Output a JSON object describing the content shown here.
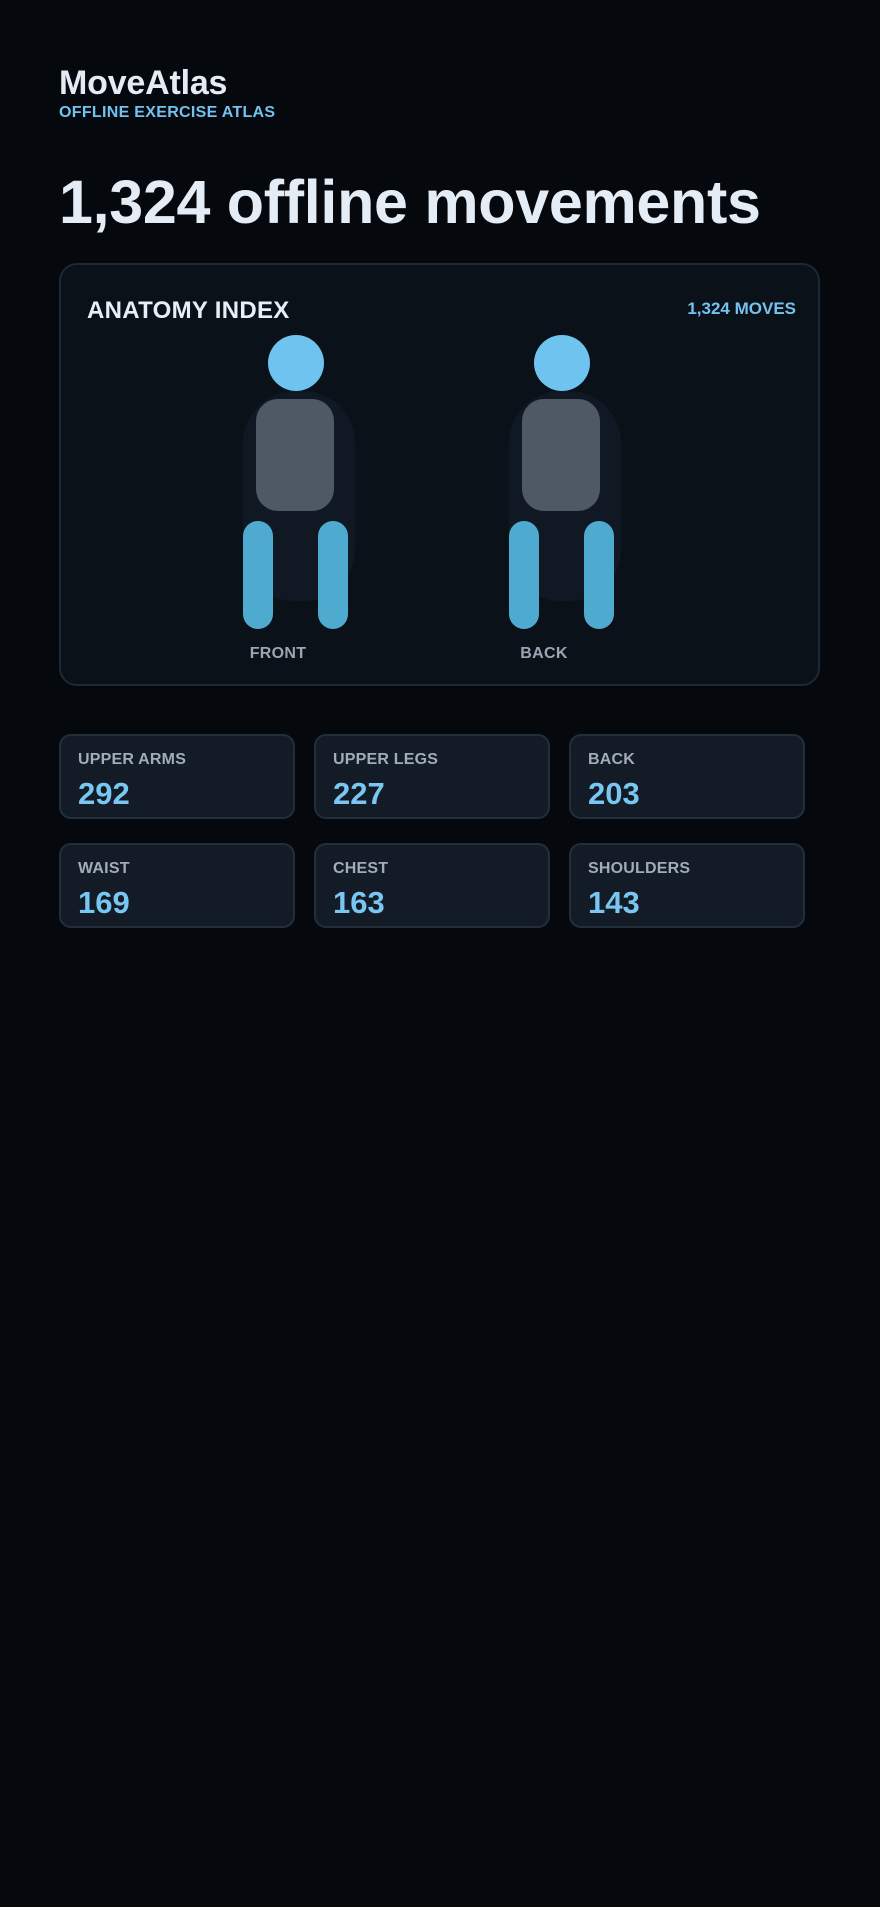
{
  "app": {
    "title": "MoveAtlas",
    "subtitle": "OFFLINE EXERCISE ATLAS"
  },
  "headline": "1,324 offline movements",
  "anatomy": {
    "title": "ANATOMY INDEX",
    "count_label": "1,324 MOVES",
    "figures": [
      {
        "label": "FRONT"
      },
      {
        "label": "BACK"
      }
    ]
  },
  "stats": [
    {
      "label": "UPPER ARMS",
      "value": "292"
    },
    {
      "label": "UPPER LEGS",
      "value": "227"
    },
    {
      "label": "BACK",
      "value": "203"
    },
    {
      "label": "WAIST",
      "value": "169"
    },
    {
      "label": "CHEST",
      "value": "163"
    },
    {
      "label": "SHOULDERS",
      "value": "143"
    }
  ],
  "colors": {
    "background": "#05080d",
    "accent": "#74c2ef",
    "card": "#0b1118",
    "torso": "#4e5965",
    "legs": "#4eaace"
  }
}
